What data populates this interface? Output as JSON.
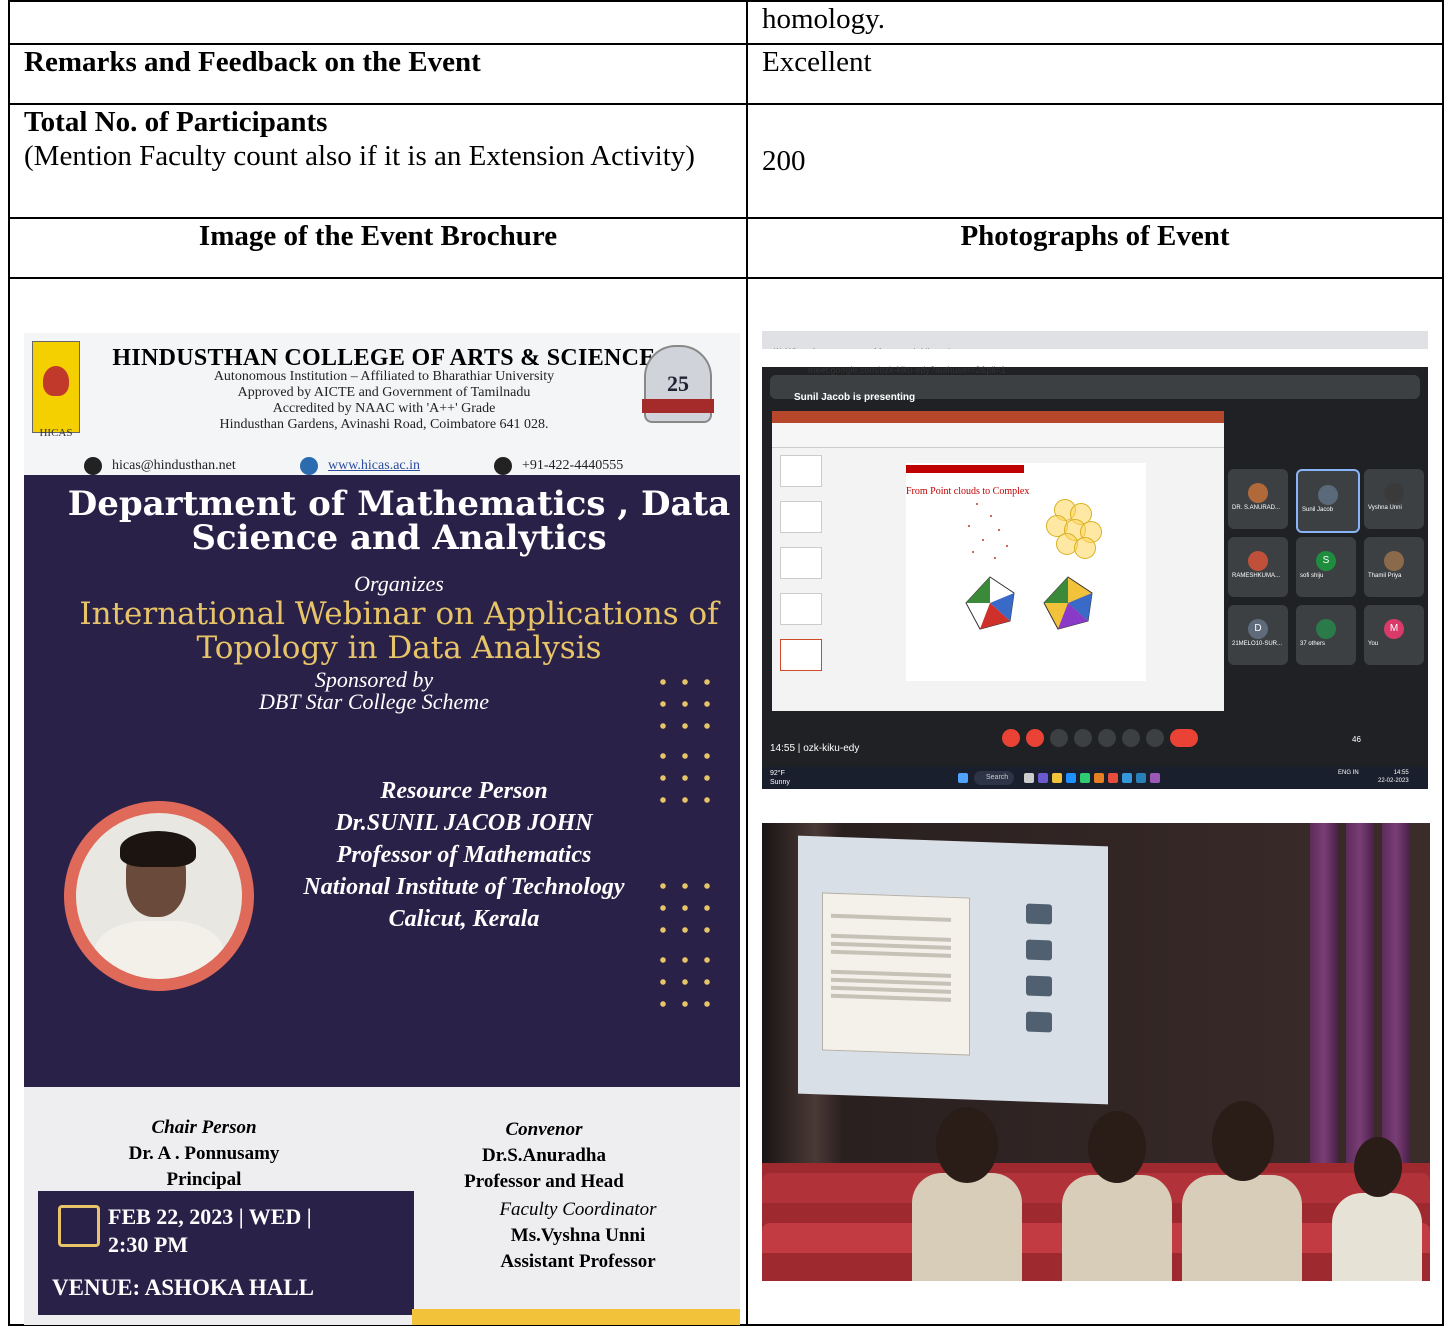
{
  "table": {
    "row1": {
      "left": "",
      "right": "homology."
    },
    "row2": {
      "left": "Remarks and Feedback on the Event",
      "right": "Excellent"
    },
    "row3": {
      "left_title": "Total No. of Participants",
      "left_note": "(Mention Faculty count also if it is an Extension Activity)",
      "right": "200"
    },
    "row4": {
      "left": "Image of the Event Brochure",
      "right": "Photographs of Event"
    }
  },
  "brochure": {
    "college": "HINDUSTHAN COLLEGE OF ARTS & SCIENCE",
    "college_lines": [
      "Autonomous Institution – Affiliated to Bharathiar University",
      "Approved by AICTE and Government of Tamilnadu",
      "Accredited by NAAC with 'A++' Grade",
      "Hindusthan Gardens, Avinashi Road, Coimbatore 641 028."
    ],
    "logo_text": "HICAS",
    "logo_right_text": "25",
    "email": "hicas@hindusthan.net",
    "website": "www.hicas.ac.in",
    "phone": "+91-422-4440555",
    "department": "Department of Mathematics , Data Science and Analytics",
    "organizes": "Organizes",
    "webinar": "International Webinar on Applications of Topology in Data Analysis",
    "sponsored_by": "Sponsored by",
    "scheme": "DBT Star College Scheme",
    "resource_person_label": "Resource Person",
    "resource_person_name": "Dr.SUNIL JACOB JOHN",
    "resource_person_role": "Professor of Mathematics",
    "resource_person_inst": "National Institute of Technology",
    "resource_person_place": "Calicut, Kerala",
    "chair_label": "Chair Person",
    "chair_name": "Dr. A . Ponnusamy",
    "chair_role": "Principal",
    "convenor_label": "Convenor",
    "convenor_name": "Dr.S.Anuradha",
    "convenor_role": "Professor and Head",
    "date": "FEB 22, 2023 | WED |",
    "time": "2:30 PM",
    "venue": "VENUE: ASHOKA HALL",
    "coordinator_label": "Faculty Coordinator",
    "coordinator_name": "Ms.Vyshna Unni",
    "coordinator_role": "Assistant Professor"
  },
  "meet_screenshot": {
    "tab1": "(1) WhatsApp",
    "tab2": "Meet – ozk-kiku-edy",
    "url": "meet.google.com/ozk-kiku-edy?authuser=2&pli=1",
    "presenting": "Sunil Jacob is presenting",
    "slide_title": "From Point clouds to Complex",
    "participants": [
      {
        "name": "DR. S.ANURAD...",
        "initial": "",
        "color": "#b06a3a"
      },
      {
        "name": "Sunil Jacob",
        "initial": "",
        "color": "#5a6a7a"
      },
      {
        "name": "Vyshna Unni",
        "initial": "",
        "color": "#3a3a3a"
      },
      {
        "name": "RAMESHKUMA...",
        "initial": "",
        "color": "#c0503a"
      },
      {
        "name": "sofi shiju",
        "initial": "S",
        "color": "#1e8e3e"
      },
      {
        "name": "Thamil Priya",
        "initial": "",
        "color": "#8a6a4a"
      },
      {
        "name": "21MELO10-SUR...",
        "initial": "D",
        "color": "#5f6b7a"
      },
      {
        "name": "37 others",
        "initial": "",
        "color": "#2a7a4a"
      },
      {
        "name": "You",
        "initial": "M",
        "color": "#d93a6a"
      }
    ],
    "time": "14:55",
    "meeting_code": "ozk-kiku-edy",
    "weather_temp": "92°F",
    "weather_desc": "Sunny",
    "search": "Search",
    "clock": "14:55",
    "date": "22-02-2023",
    "lang": "ENG IN",
    "people_count": "46"
  },
  "colors": {
    "brochure_panel": "#2a2148",
    "brochure_gold": "#e8c468",
    "meet_bg": "#202124",
    "meet_red": "#ea4335"
  }
}
